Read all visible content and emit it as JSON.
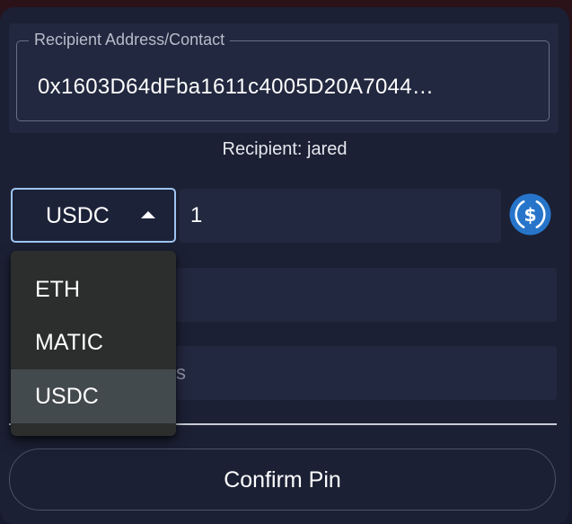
{
  "recipient": {
    "label": "Recipient Address/Contact",
    "value": "0x1603D64dFba1611c4005D20A7044…",
    "caption": "Recipient: jared"
  },
  "token_select": {
    "selected": "USDC",
    "options": [
      "ETH",
      "MATIC",
      "USDC"
    ]
  },
  "amount": {
    "value": "1"
  },
  "token_icon": "usdc-icon",
  "hidden_field_text": "s",
  "confirm": {
    "label": "Confirm Pin"
  },
  "colors": {
    "accent_border": "#9ec4f0",
    "usdc_blue": "#2775ca",
    "card_bg": "#1b2034",
    "field_bg": "#22283f",
    "dropdown_bg": "#2c2e2e",
    "dropdown_selected_bg": "#434a4d"
  }
}
